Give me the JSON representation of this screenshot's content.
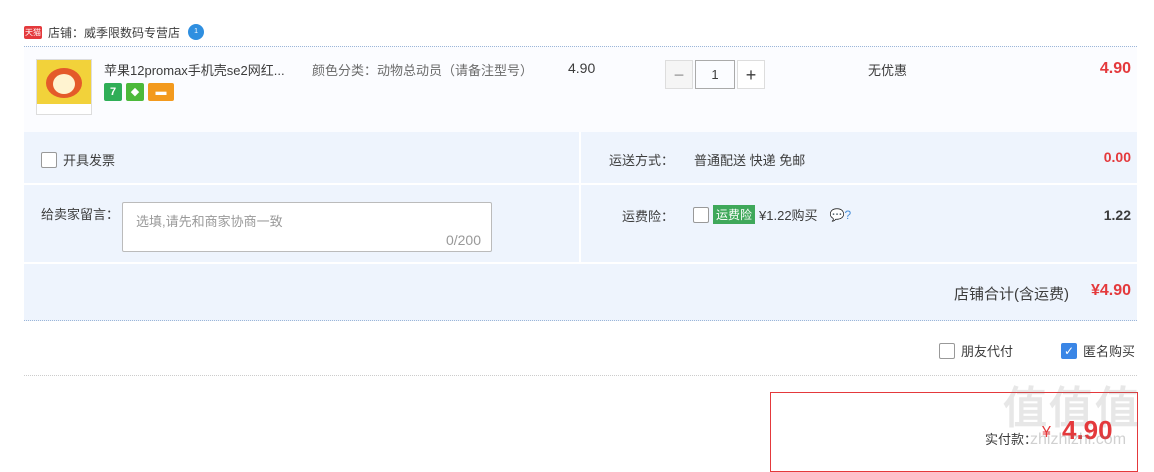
{
  "shop": {
    "badge": "天猫",
    "label": "店铺：威季限数码专营店",
    "im_icon_text": "1"
  },
  "item": {
    "title": "苹果12promax手机壳se2网红...",
    "spec": "颜色分类：动物总动员（请备注型号）",
    "unit_price": "4.90",
    "quantity": "1",
    "minus": "−",
    "plus": "+",
    "discount": "无优惠",
    "subtotal": "4.90",
    "badge_7": "7"
  },
  "options": {
    "invoice_label": "开具发票",
    "shipping_label": "运送方式：",
    "shipping_value": "普通配送 快递 免邮",
    "shipping_fee": "0.00",
    "message_label": "给卖家留言：",
    "message_placeholder": "选填,请先和商家协商一致",
    "message_count": "0/200",
    "insurance_label": "运费险：",
    "insurance_tag": "运费险",
    "insurance_price": "¥1.22购买",
    "insurance_icons": "💬?",
    "insurance_fee": "1.22",
    "total_label": "店铺合计(含运费)",
    "total_value": "¥4.90"
  },
  "extras": {
    "friend_pay": "朋友代付",
    "anonymous_buy": "匿名购买",
    "anonymous_checked": true
  },
  "payment": {
    "label": "实付款：",
    "currency": "¥",
    "amount": "4.90"
  },
  "watermark": {
    "top": "值值值",
    "bottom": "zhizhizhi.com"
  },
  "colors": {
    "price_red": "#e4393c",
    "panel_blue": "#eef4fd",
    "checkbox_blue": "#3a86e6",
    "insurance_green": "#3fa85a"
  }
}
